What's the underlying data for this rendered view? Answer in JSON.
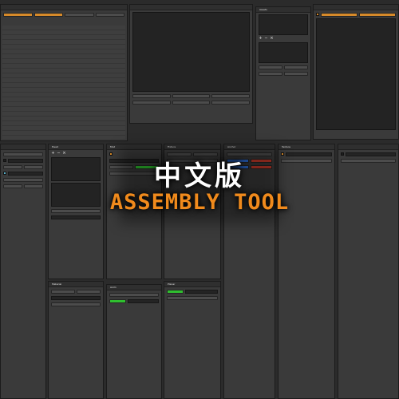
{
  "overlay": {
    "title_zh": "中文版",
    "title_en": "ASSEMBLY TOOL"
  },
  "panels": {
    "outliner": "",
    "assets": "Assets",
    "editor": "",
    "board": "",
    "object_p": "",
    "panel_h": "Head",
    "material": "Material",
    "mod": "Mod",
    "fixture": "Fixture",
    "anchor": "Anchor",
    "texture": "Texture",
    "anim": "Anim",
    "plane": "Planar"
  },
  "colors": {
    "accent": "#d68a2a",
    "panel_bg": "#3a3a3a",
    "title_en": "#f08a1c",
    "title_zh": "#ffffff"
  }
}
